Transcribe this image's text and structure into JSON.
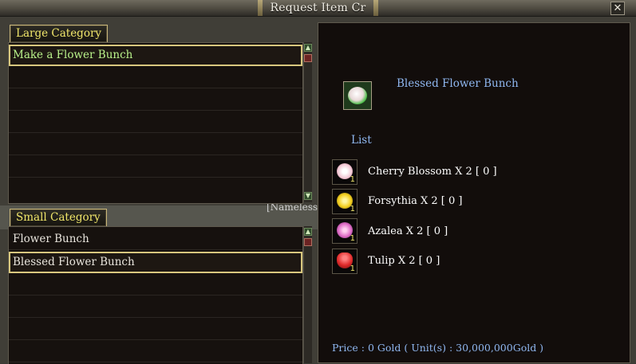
{
  "window": {
    "title": "Request Item Cr",
    "close_label": "✕"
  },
  "large_category": {
    "tab_label": "Large Category",
    "items": [
      "Make a Flower Bunch"
    ]
  },
  "small_category": {
    "tab_label": "Small Category",
    "items": [
      "Flower Bunch",
      "Blessed Flower Bunch"
    ]
  },
  "background": {
    "nameless_text": "[Nameless"
  },
  "detail": {
    "item_name": "Blessed Flower Bunch",
    "list_label": "List",
    "materials": [
      {
        "text": "Cherry Blossom X 2 [ 0 ]",
        "qty": "1",
        "color": "#f3c9d6"
      },
      {
        "text": "Forsythia X 2 [ 0 ]",
        "qty": "1",
        "color": "#f4d020"
      },
      {
        "text": "Azalea X 2 [ 0 ]",
        "qty": "1",
        "color": "#e070c8"
      },
      {
        "text": "Tulip X 2 [ 0 ]",
        "qty": "1",
        "color": "#e02a2a"
      }
    ],
    "price_text": "Price : 0 Gold ( Unit(s) : 30,000,000Gold )"
  },
  "colors": {
    "accent_gold": "#d8c77e",
    "tab_text": "#f0e66a",
    "info_blue": "#8fb7f0",
    "large_item_green": "#b9f28a"
  }
}
